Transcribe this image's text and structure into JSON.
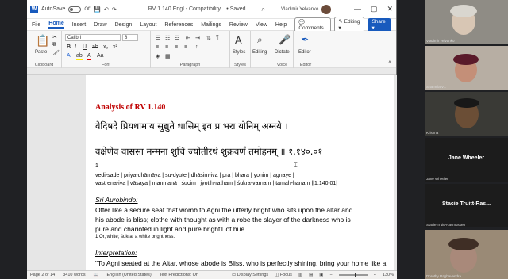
{
  "titlebar": {
    "autosave": "AutoSave",
    "autosave_state": "Off",
    "doc_title": "RV 1.140 Engl - Compatibility... • Saved",
    "user": "Vladimir Yelvanko",
    "controls": [
      "—",
      "▢",
      "✕"
    ]
  },
  "menu": {
    "tabs": [
      "File",
      "Home",
      "Insert",
      "Draw",
      "Design",
      "Layout",
      "References",
      "Mailings",
      "Review",
      "View",
      "Help"
    ],
    "active": "Home",
    "comments": "Comments",
    "editing": "Editing",
    "share": "Share"
  },
  "ribbon": {
    "clipboard": {
      "label": "Clipboard",
      "paste": "Paste"
    },
    "font": {
      "label": "Font",
      "name": "Calibri",
      "size": "8",
      "bold": "B",
      "italic": "I",
      "underline": "U"
    },
    "paragraph": {
      "label": "Paragraph"
    },
    "styles": {
      "label": "Styles",
      "button": "Styles"
    },
    "editing": {
      "button": "Editing"
    },
    "voice": {
      "label": "Voice",
      "button": "Dictate"
    },
    "editor": {
      "label": "Editor",
      "button": "Editor"
    }
  },
  "document": {
    "heading": "Analysis of RV 1.140",
    "sanskrit_line1": "वेदिषदे प्रियधामाय सुद्युते धासिम् इव प्र भरा योनिम् अग्नये ।",
    "sanskrit_line2": "वक्षेणेव वाससा मन्मना शुचिं ज्योतीरथं शुक्रवर्णं तमोहनम् ॥ १.१४०.०१",
    "footnote_marker": "1",
    "translit_line1": "vedi-sade | priya-dhāmāya | su-dyute | dhāsim-iva | pra | bhara | yonim | agnaye |",
    "translit_line2": "vastrena-iva | vāsaya | manmanā | śucim | jyotih-ratham | śukra-varnam | tamah-hanam ||1.140.01|",
    "aurobindo_heading": "Sri Aurobindo:",
    "aurobindo_p1": "Offer like a secure seat that womb to Agni the utterly bright who sits upon the altar and",
    "aurobindo_p2": "his abode is bliss; clothe with thought as with a robe the slayer of the darkness who is",
    "aurobindo_p3": "pure and charioted in light and pure bright1 of hue.",
    "footnote": "1 Or, white; śukra, a white brightness.",
    "interpretation_heading": "Interpretation:",
    "interpretation_p1": "\"To Agni seated at the Altar, whose abode is Bliss, who is perfectly shining, bring your home like a"
  },
  "statusbar": {
    "page": "Page 2 of 14",
    "words": "3410 words",
    "language": "English (United States)",
    "predictions": "Text Predictions: On",
    "display": "Display Settings",
    "focus": "Focus",
    "zoom": "130%"
  },
  "participants": [
    {
      "name": "Vladimir Yelvanko",
      "type": "video"
    },
    {
      "name": "Sharmila V...",
      "type": "video"
    },
    {
      "name": "Krishna",
      "type": "video"
    },
    {
      "name": "Jane Wheeler",
      "type": "name-only"
    },
    {
      "name": "Stacie Truitt-Ras...",
      "sub": "Stacie Truitt-Rasmussen",
      "type": "name-only"
    },
    {
      "name": "Dorothy Raghavendra",
      "type": "video"
    }
  ]
}
